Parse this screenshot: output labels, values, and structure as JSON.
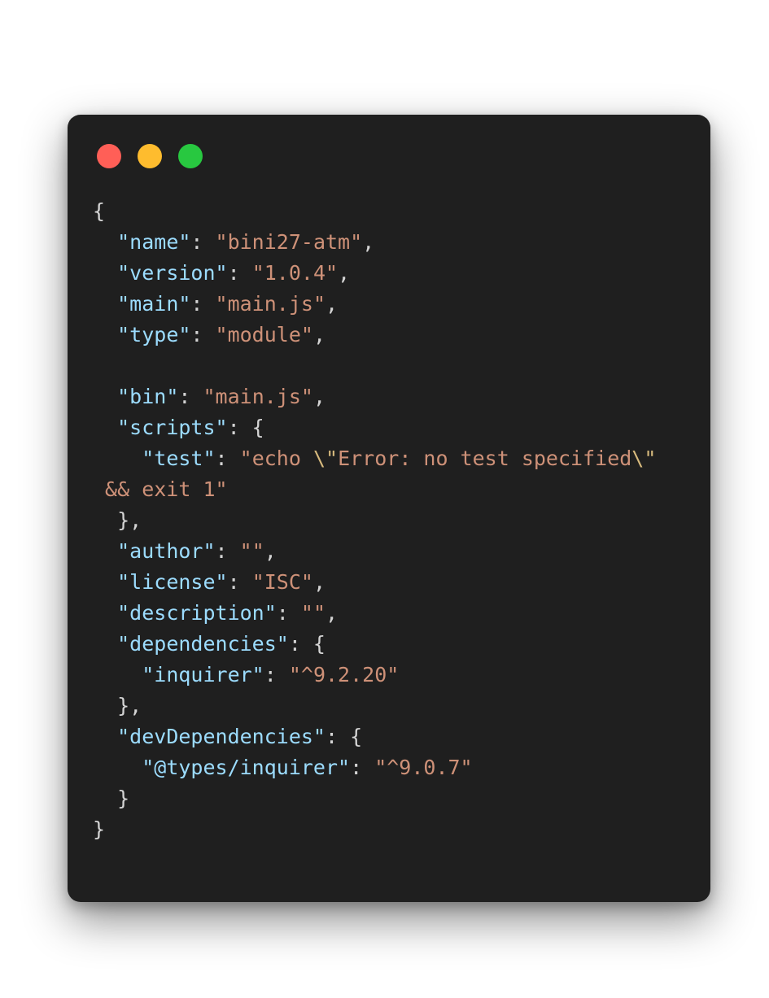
{
  "window": {
    "controls": {
      "close_color": "#ff5f57",
      "minimize_color": "#febc2e",
      "maximize_color": "#28c840"
    }
  },
  "theme": {
    "background": "#1f1f1f",
    "key_color": "#9cdcfe",
    "string_color": "#ce9178",
    "escape_color": "#d7ba7d",
    "punctuation_color": "#d4d4d4"
  },
  "code": {
    "lines": [
      [
        {
          "t": "p",
          "v": "{"
        }
      ],
      [
        {
          "t": "p",
          "v": "  "
        },
        {
          "t": "k",
          "v": "\"name\""
        },
        {
          "t": "p",
          "v": ": "
        },
        {
          "t": "s",
          "v": "\"bini27-atm\""
        },
        {
          "t": "p",
          "v": ","
        }
      ],
      [
        {
          "t": "p",
          "v": "  "
        },
        {
          "t": "k",
          "v": "\"version\""
        },
        {
          "t": "p",
          "v": ": "
        },
        {
          "t": "s",
          "v": "\"1.0.4\""
        },
        {
          "t": "p",
          "v": ","
        }
      ],
      [
        {
          "t": "p",
          "v": "  "
        },
        {
          "t": "k",
          "v": "\"main\""
        },
        {
          "t": "p",
          "v": ": "
        },
        {
          "t": "s",
          "v": "\"main.js\""
        },
        {
          "t": "p",
          "v": ","
        }
      ],
      [
        {
          "t": "p",
          "v": "  "
        },
        {
          "t": "k",
          "v": "\"type\""
        },
        {
          "t": "p",
          "v": ": "
        },
        {
          "t": "s",
          "v": "\"module\""
        },
        {
          "t": "p",
          "v": ","
        }
      ],
      [],
      [
        {
          "t": "p",
          "v": "  "
        },
        {
          "t": "k",
          "v": "\"bin\""
        },
        {
          "t": "p",
          "v": ": "
        },
        {
          "t": "s",
          "v": "\"main.js\""
        },
        {
          "t": "p",
          "v": ","
        }
      ],
      [
        {
          "t": "p",
          "v": "  "
        },
        {
          "t": "k",
          "v": "\"scripts\""
        },
        {
          "t": "p",
          "v": ": {"
        }
      ],
      [
        {
          "t": "p",
          "v": "    "
        },
        {
          "t": "k",
          "v": "\"test\""
        },
        {
          "t": "p",
          "v": ": "
        },
        {
          "t": "s",
          "v": "\"echo "
        },
        {
          "t": "e",
          "v": "\\\""
        },
        {
          "t": "s",
          "v": "Error: no test specified"
        },
        {
          "t": "e",
          "v": "\\\""
        }
      ],
      [
        {
          "t": "s",
          "v": " && exit 1\""
        }
      ],
      [
        {
          "t": "p",
          "v": "  },"
        }
      ],
      [
        {
          "t": "p",
          "v": "  "
        },
        {
          "t": "k",
          "v": "\"author\""
        },
        {
          "t": "p",
          "v": ": "
        },
        {
          "t": "s",
          "v": "\"\""
        },
        {
          "t": "p",
          "v": ","
        }
      ],
      [
        {
          "t": "p",
          "v": "  "
        },
        {
          "t": "k",
          "v": "\"license\""
        },
        {
          "t": "p",
          "v": ": "
        },
        {
          "t": "s",
          "v": "\"ISC\""
        },
        {
          "t": "p",
          "v": ","
        }
      ],
      [
        {
          "t": "p",
          "v": "  "
        },
        {
          "t": "k",
          "v": "\"description\""
        },
        {
          "t": "p",
          "v": ": "
        },
        {
          "t": "s",
          "v": "\"\""
        },
        {
          "t": "p",
          "v": ","
        }
      ],
      [
        {
          "t": "p",
          "v": "  "
        },
        {
          "t": "k",
          "v": "\"dependencies\""
        },
        {
          "t": "p",
          "v": ": {"
        }
      ],
      [
        {
          "t": "p",
          "v": "    "
        },
        {
          "t": "k",
          "v": "\"inquirer\""
        },
        {
          "t": "p",
          "v": ": "
        },
        {
          "t": "s",
          "v": "\"^9.2.20\""
        }
      ],
      [
        {
          "t": "p",
          "v": "  },"
        }
      ],
      [
        {
          "t": "p",
          "v": "  "
        },
        {
          "t": "k",
          "v": "\"devDependencies\""
        },
        {
          "t": "p",
          "v": ": {"
        }
      ],
      [
        {
          "t": "p",
          "v": "    "
        },
        {
          "t": "k",
          "v": "\"@types/inquirer\""
        },
        {
          "t": "p",
          "v": ": "
        },
        {
          "t": "s",
          "v": "\"^9.0.7\""
        }
      ],
      [
        {
          "t": "p",
          "v": "  }"
        }
      ],
      [
        {
          "t": "p",
          "v": "}"
        }
      ]
    ]
  }
}
